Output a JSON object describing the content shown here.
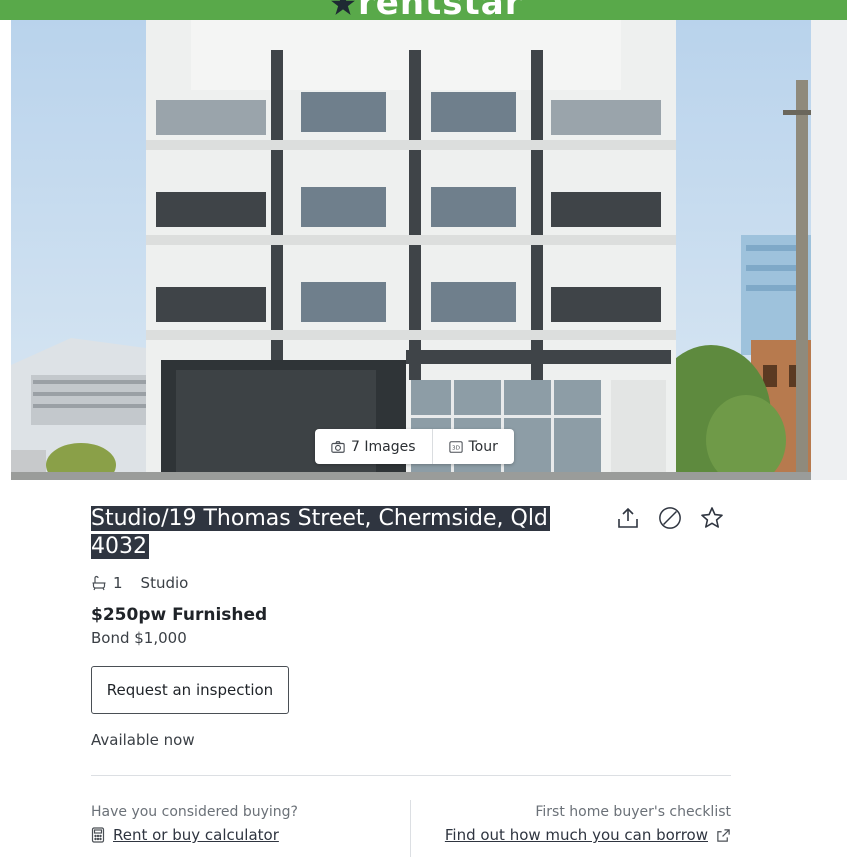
{
  "header": {
    "logo_text": "rentstar",
    "brand_color": "#59a94a"
  },
  "gallery": {
    "images_button": {
      "icon": "camera-icon",
      "label": "7 Images"
    },
    "tour_button": {
      "icon": "tour-3d-icon",
      "label": "Tour"
    }
  },
  "listing": {
    "title": "Studio/19 Thomas Street, Chermside, Qld 4032",
    "features": {
      "bathrooms": "1",
      "type": "Studio"
    },
    "price": "$250pw Furnished",
    "bond": "Bond $1,000",
    "inspection_button": "Request an inspection",
    "availability": "Available now"
  },
  "actions": {
    "share_icon": "share-icon",
    "hide_icon": "hide-icon",
    "favourite_icon": "star-icon"
  },
  "footer": {
    "left_question": "Have you considered buying?",
    "left_link": "Rent or buy calculator",
    "right_question": "First home buyer's checklist",
    "right_link": "Find out how much you can borrow"
  }
}
